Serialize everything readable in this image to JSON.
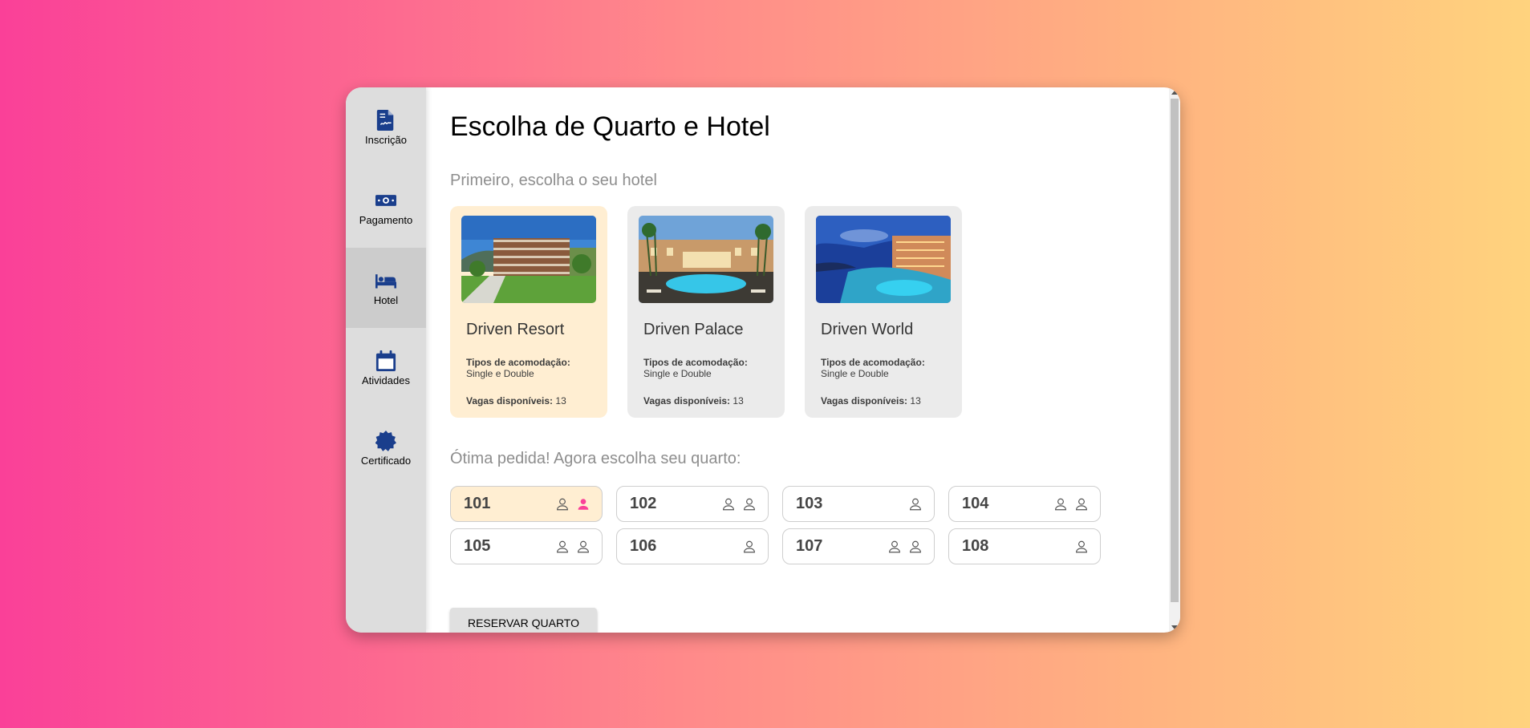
{
  "nav": {
    "items": [
      {
        "label": "Inscrição",
        "icon": "file-contract-icon"
      },
      {
        "label": "Pagamento",
        "icon": "money-bill-icon"
      },
      {
        "label": "Hotel",
        "icon": "bed-icon",
        "active": true
      },
      {
        "label": "Atividades",
        "icon": "calendar-icon"
      },
      {
        "label": "Certificado",
        "icon": "certificate-icon"
      }
    ]
  },
  "main": {
    "title": "Escolha de Quarto e Hotel",
    "hotels_subtitle": "Primeiro, escolha o seu hotel",
    "hotels": [
      {
        "name": "Driven Resort",
        "types_label": "Tipos de acomodação:",
        "types": "Single e Double",
        "vagas_label": "Vagas disponíveis:",
        "vagas": "13",
        "selected": true
      },
      {
        "name": "Driven Palace",
        "types_label": "Tipos de acomodação:",
        "types": "Single e Double",
        "vagas_label": "Vagas disponíveis:",
        "vagas": "13",
        "selected": false
      },
      {
        "name": "Driven World",
        "types_label": "Tipos de acomodação:",
        "types": "Single e Double",
        "vagas_label": "Vagas disponíveis:",
        "vagas": "13",
        "selected": false
      }
    ],
    "rooms_subtitle": "Ótima pedida! Agora escolha seu quarto:",
    "rooms": [
      {
        "number": "101",
        "capacity": 2,
        "occupied": 0,
        "selected": true
      },
      {
        "number": "102",
        "capacity": 2,
        "occupied": 0,
        "selected": false
      },
      {
        "number": "103",
        "capacity": 1,
        "occupied": 0,
        "selected": false
      },
      {
        "number": "104",
        "capacity": 2,
        "occupied": 0,
        "selected": false
      },
      {
        "number": "105",
        "capacity": 2,
        "occupied": 0,
        "selected": false
      },
      {
        "number": "106",
        "capacity": 1,
        "occupied": 0,
        "selected": false
      },
      {
        "number": "107",
        "capacity": 2,
        "occupied": 0,
        "selected": false
      },
      {
        "number": "108",
        "capacity": 1,
        "occupied": 0,
        "selected": false
      }
    ],
    "reserve_button": "RESERVAR QUARTO"
  },
  "colors": {
    "nav_icon": "#1a3e8c",
    "selected_bg": "#ffeed2",
    "selected_person": "#fa4098"
  }
}
